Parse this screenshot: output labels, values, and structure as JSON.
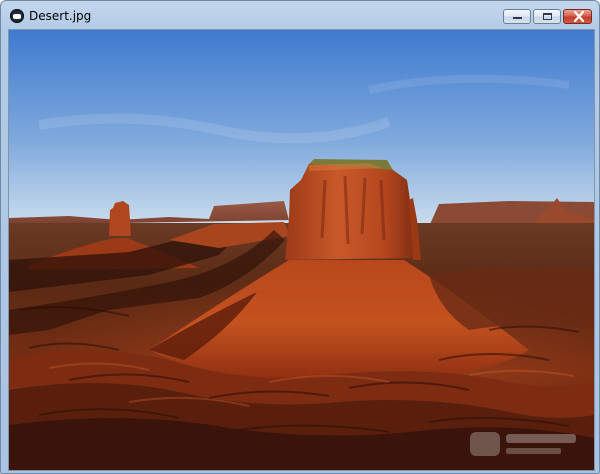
{
  "window": {
    "title": "Desert.jpg",
    "app_icon": "image-viewer-icon",
    "controls": {
      "minimize_icon": "minimize-icon",
      "maximize_icon": "maximize-icon",
      "close_icon": "close-icon"
    }
  },
  "image": {
    "subject": "desert-mesa-photo",
    "colors": {
      "sky_top": "#3f7ad0",
      "sky_bottom": "#cfe0ee",
      "rock": "#b5451d",
      "shadow": "#2a0f07"
    }
  },
  "watermark": {
    "icon": "watermark-logo"
  }
}
